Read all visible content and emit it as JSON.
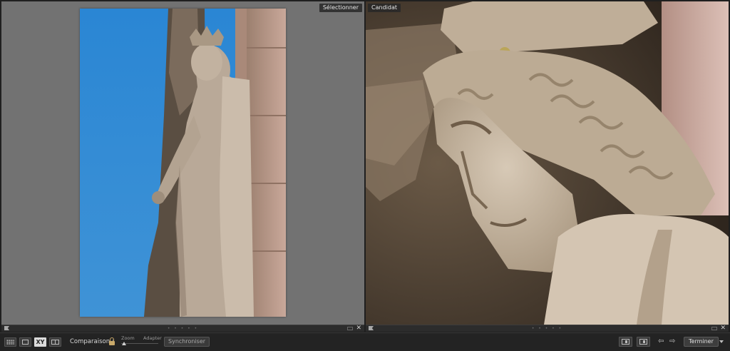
{
  "left_pane": {
    "label": "Sélectionner"
  },
  "right_pane": {
    "label": "Candidat"
  },
  "toolbar": {
    "compare_label": "Comparaison :",
    "zoom_label": "Zoom",
    "fit_label": "Adapter",
    "sync_label": "Synchroniser",
    "done_label": "Terminer",
    "compare_view_label": "XY",
    "prev_arrow": "⇦",
    "next_arrow": "⇨"
  },
  "icons": {
    "grid_view": "grid-icon",
    "loupe_view": "loupe-icon",
    "compare_view": "compare-icon",
    "survey_view": "survey-icon",
    "lock": "unlock-icon",
    "swap": "swap-icon",
    "make_select": "make-select-icon",
    "flag": "flag-icon",
    "close": "close-icon"
  },
  "colors": {
    "left_background": "#727272",
    "sky": "#2b86d2",
    "stone": "#b7a795",
    "lock_gold": "#c9a96a"
  }
}
